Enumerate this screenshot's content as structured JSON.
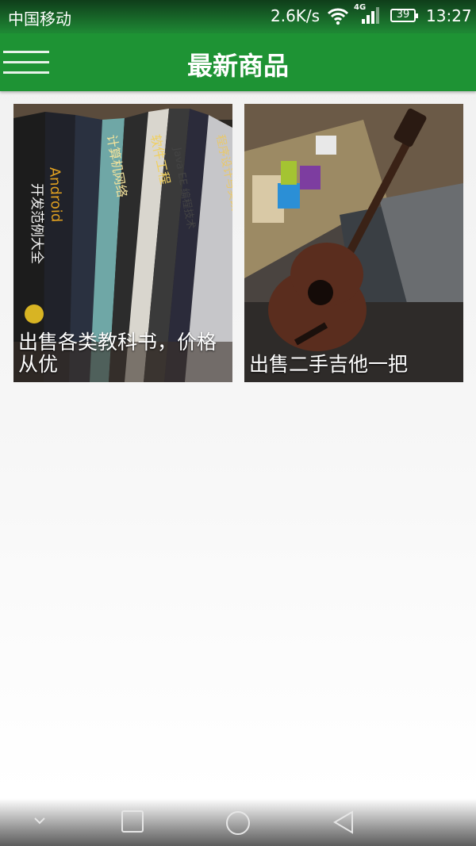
{
  "status_bar": {
    "carrier": "中国移动",
    "net_speed": "2.6K/s",
    "network_type": "4G",
    "battery_level": "39",
    "time": "13:27",
    "icons": [
      "wifi-icon",
      "signal-icon",
      "battery-icon"
    ]
  },
  "app_bar": {
    "title": "最新商品",
    "menu_icon": "hamburger-menu-icon"
  },
  "products": [
    {
      "title": "出售各类教科书，价格从优",
      "image": "stacked textbooks photo"
    },
    {
      "title": "出售二手吉他一把",
      "image": "acoustic guitar photo"
    }
  ],
  "nav_bar": {
    "buttons": [
      "collapse-icon",
      "recent-apps-icon",
      "home-icon",
      "back-icon"
    ]
  },
  "colors": {
    "primary": "#1e9334",
    "status_bar": "#0f3d1a",
    "background": "#f0f0f0"
  }
}
